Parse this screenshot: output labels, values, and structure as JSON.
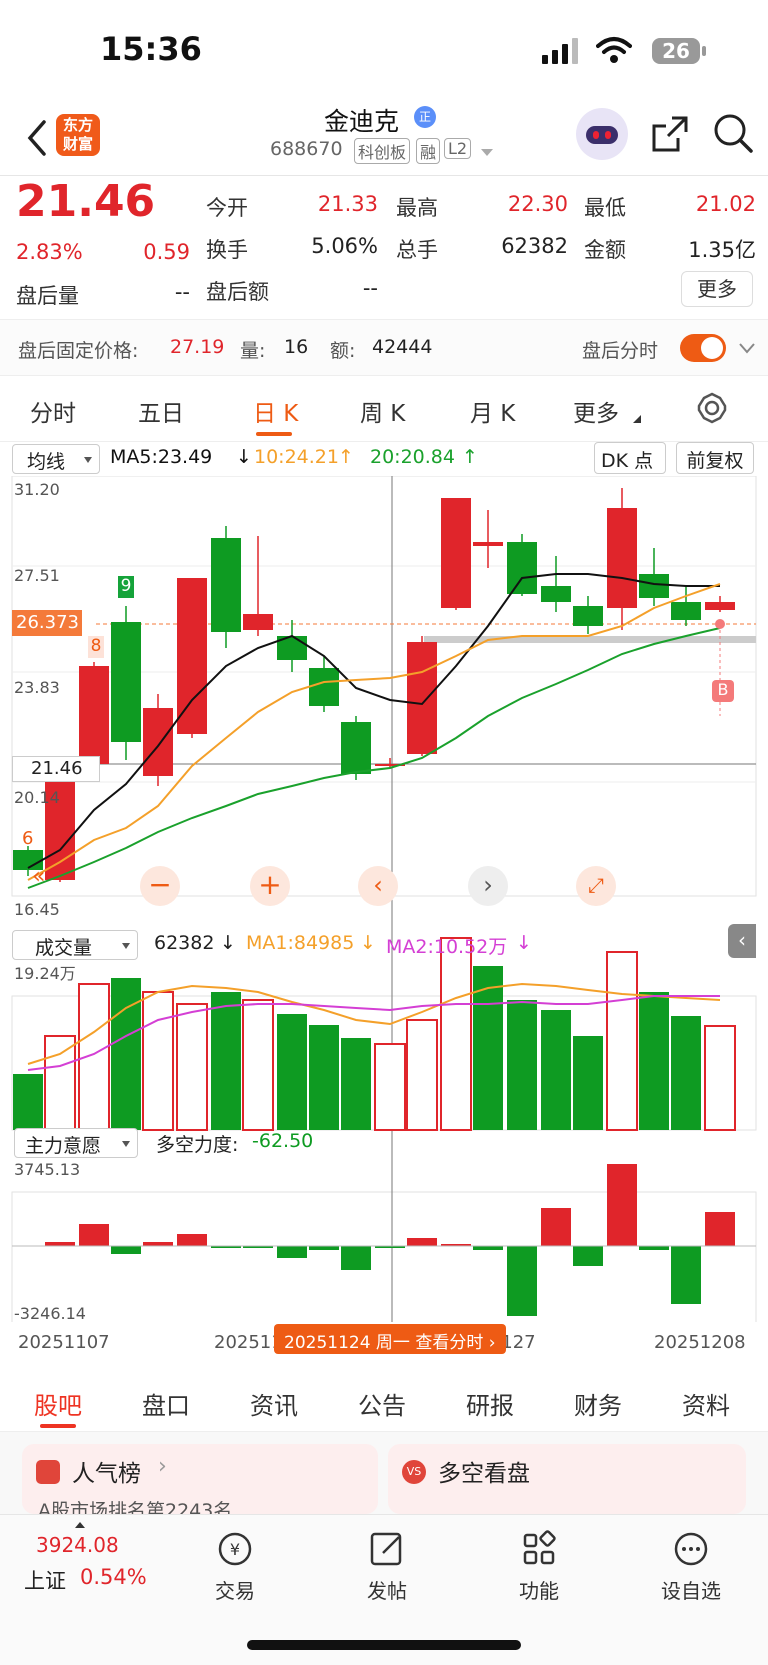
{
  "status": {
    "time": "15:36",
    "battery": "26"
  },
  "header": {
    "title": "金迪克",
    "title_badge": "正",
    "code": "688670",
    "tags": [
      "科创板",
      "融",
      "L2"
    ],
    "logo_lines": [
      "东方",
      "财富"
    ]
  },
  "quote": {
    "price": "21.46",
    "change_pct": "2.83%",
    "change": "0.59",
    "fields": [
      {
        "label": "今开",
        "value": "21.33",
        "color": "red"
      },
      {
        "label": "最高",
        "value": "22.30",
        "color": "red"
      },
      {
        "label": "最低",
        "value": "21.02",
        "color": "red"
      },
      {
        "label": "换手",
        "value": "5.06%",
        "color": "dark"
      },
      {
        "label": "总手",
        "value": "62382",
        "color": "dark"
      },
      {
        "label": "金额",
        "value": "1.35亿",
        "color": "dark"
      },
      {
        "label": "盘后量",
        "value": "--",
        "color": "dark"
      },
      {
        "label": "盘后额",
        "value": "--",
        "color": "dark"
      }
    ],
    "more_label": "更多"
  },
  "after_hours": {
    "fixed_price_label": "盘后固定价格:",
    "fixed_price": "27.19",
    "volume_label": "量:",
    "volume": "16",
    "amount_label": "额:",
    "amount": "42444",
    "timeshare_label": "盘后分时"
  },
  "tabs": [
    "分时",
    "五日",
    "日 K",
    "周 K",
    "月 K",
    "更多"
  ],
  "active_tab": 2,
  "kline": {
    "indicator_select": "均线",
    "ma5": "MA5:23.49",
    "ma10": "10:24.21",
    "ma20": "20:20.84",
    "dk_label": "DK 点",
    "fq_label": "前复权",
    "y_ticks": [
      "31.20",
      "27.51",
      "23.83",
      "20.14",
      "16.45"
    ],
    "cursor_price": "26.373",
    "cursor_left_price": "21.46",
    "markers": {
      "six": "6",
      "eight": "8",
      "nine": "9",
      "b": "B"
    }
  },
  "volume": {
    "select": "成交量",
    "value": "62382",
    "ma1": "MA1:84985",
    "ma2": "MA2:10.52万",
    "y_top": "19.24万"
  },
  "force": {
    "select": "主力意愿",
    "label": "多空力度:",
    "value": "-62.50",
    "y_top": "3745.13",
    "y_bottom": "-3246.14"
  },
  "x_axis": {
    "left": "20251107",
    "mid": "20251114",
    "mid2": "20251127",
    "right": "20251208",
    "cursor_label": "20251124 周一 查看分时"
  },
  "bottom_tabs": [
    "股吧",
    "盘口",
    "资讯",
    "公告",
    "研报",
    "财务",
    "资料"
  ],
  "cards": [
    {
      "title": "人气榜",
      "sub": "A股市场排名第2243名"
    },
    {
      "title": "多空看盘",
      "sub": ""
    }
  ],
  "toolbar": {
    "index_value": "3924.08",
    "index_name": "上证",
    "index_change": "0.54%",
    "items": [
      "交易",
      "发帖",
      "功能",
      "设自选"
    ]
  },
  "colors": {
    "up": "#e0252b",
    "down": "#0e9b22",
    "accent": "#ee5b14"
  }
}
